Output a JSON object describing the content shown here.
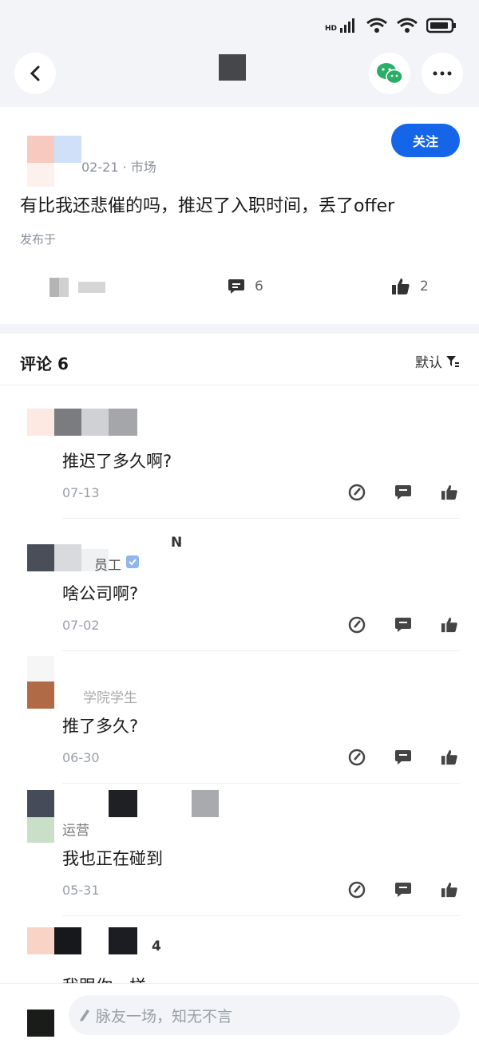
{
  "status_bar": {
    "signal_label": "HD"
  },
  "post": {
    "date_channel": "02-21 · 市场",
    "text": "有比我还悲催的吗，推迟了入职时间，丢了offer",
    "published_prefix": "发布于",
    "follow_label": "关注",
    "comment_count": "6",
    "like_count": "2"
  },
  "comments_header": {
    "title": "评论 6",
    "sort_label": "默认"
  },
  "comments": [
    {
      "text": "推迟了多久啊?",
      "date": "07-13"
    },
    {
      "text": "啥公司啊?",
      "date": "07-02",
      "name_tail": "N",
      "name_part": "员工"
    },
    {
      "text": "推了多久?",
      "date": "06-30",
      "name_part": "学院学生"
    },
    {
      "text": "我也正在碰到",
      "date": "05-31",
      "name_part": "运营"
    },
    {
      "text": "我跟你一样",
      "name_tail": "4"
    }
  ],
  "bottom_input": {
    "placeholder": "脉友一场，知无不言"
  },
  "colors": {
    "accent": "#1565e8",
    "wechat": "#2aae67",
    "background": "#f2f4f7"
  }
}
